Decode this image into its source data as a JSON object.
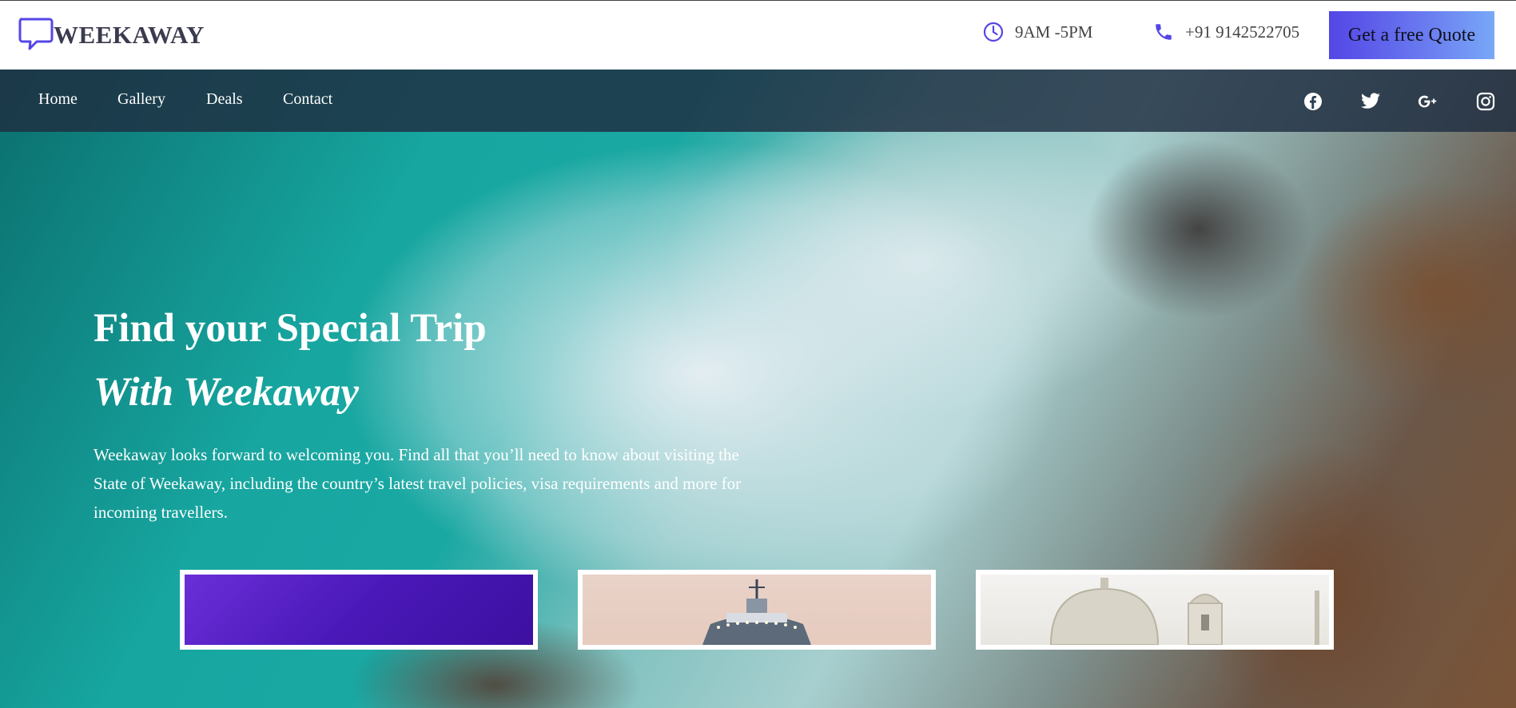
{
  "brand": {
    "name": "WEEKAWAY",
    "icon": "chat-bubble-icon",
    "accent": "#5446e6"
  },
  "contact": {
    "hours": "9AM -5PM",
    "hours_icon": "clock-icon",
    "phone": "+91 9142522705",
    "phone_icon": "phone-icon",
    "quote_button": "Get a free Quote"
  },
  "nav": {
    "items": [
      {
        "label": "Home"
      },
      {
        "label": "Gallery"
      },
      {
        "label": "Deals"
      },
      {
        "label": "Contact"
      }
    ],
    "social": [
      "facebook-icon",
      "twitter-icon",
      "google-plus-icon",
      "instagram-icon"
    ]
  },
  "hero": {
    "title": "Find your Special Trip",
    "subtitle": "With Weekaway",
    "text": "Weekaway looks forward to welcoming you. Find all that you’ll need to know about visiting the State of Weekaway, including the country’s latest travel policies, visa requirements and more for incoming travellers."
  }
}
